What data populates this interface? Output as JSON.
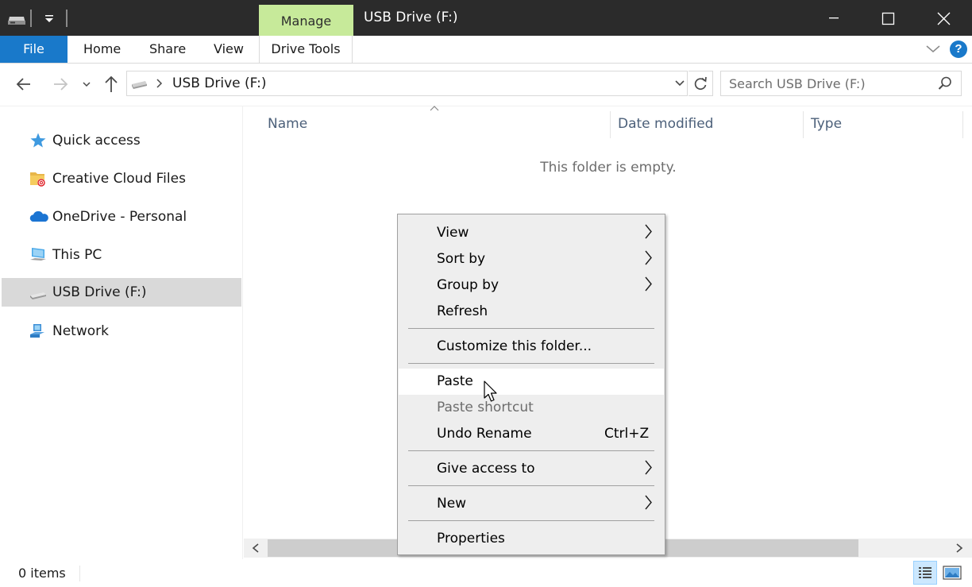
{
  "window": {
    "title": "USB Drive (F:)",
    "contextual_tab_group": "Manage"
  },
  "ribbon": {
    "file_tab": "File",
    "tabs": [
      "Home",
      "Share",
      "View",
      "Drive Tools"
    ],
    "help_label": "?"
  },
  "address": {
    "path": "USB Drive (F:)",
    "search_placeholder": "Search USB Drive (F:)"
  },
  "nav": {
    "items": [
      {
        "label": "Quick access",
        "icon": "star-icon"
      },
      {
        "label": "Creative Cloud Files",
        "icon": "creative-cloud-folder-icon"
      },
      {
        "label": "OneDrive - Personal",
        "icon": "onedrive-cloud-icon"
      },
      {
        "label": "This PC",
        "icon": "computer-icon"
      },
      {
        "label": "USB Drive (F:)",
        "icon": "usb-drive-icon",
        "selected": true
      },
      {
        "label": "Network",
        "icon": "network-icon"
      }
    ]
  },
  "content": {
    "columns": [
      "Name",
      "Date modified",
      "Type"
    ],
    "empty_message": "This folder is empty.",
    "sorted_column": "Name"
  },
  "status": {
    "item_count": "0 items"
  },
  "context_menu": {
    "items": [
      {
        "label": "View",
        "submenu": true
      },
      {
        "label": "Sort by",
        "submenu": true
      },
      {
        "label": "Group by",
        "submenu": true
      },
      {
        "label": "Refresh"
      },
      {
        "label": "Customize this folder..."
      },
      {
        "label": "Paste",
        "hovered": true
      },
      {
        "label": "Paste shortcut",
        "disabled": true
      },
      {
        "label": "Undo Rename",
        "shortcut": "Ctrl+Z"
      },
      {
        "label": "Give access to",
        "submenu": true
      },
      {
        "label": "New",
        "submenu": true
      },
      {
        "label": "Properties"
      }
    ]
  },
  "colors": {
    "accent": "#1979ca",
    "manage_tab": "#c7ea9a",
    "titlebar": "#2b2b2b",
    "selection": "#d9d9d9",
    "menu_bg": "#eeeeee"
  }
}
